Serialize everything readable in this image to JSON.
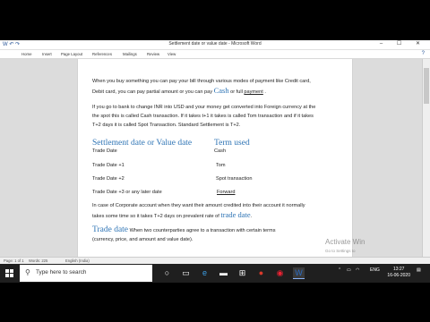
{
  "window": {
    "title": "Settlement date or value date - Microsoft Word",
    "controls": "– ☐ ✕"
  },
  "ribbon": {
    "tabs": [
      "Home",
      "Insert",
      "Page Layout",
      "References",
      "Mailings",
      "Review",
      "View"
    ]
  },
  "document": {
    "p1_part1": "When you buy something you can pay your bill through various modes of payment like Credit card,",
    "p1_part2a": "Debit card, you can pay partial amount  or you can pay ",
    "p1_cash": "Cash",
    "p1_part2b": " or full ",
    "p1_full": "payment",
    "p1_end": " .",
    "p2_line1": "If you go to bank to change INR into USD and your money get converted into Foreign currency at the",
    "p2_line2": "the spot this is called Cash transaction. If it takes t+1 it takes is called Tom transaction and if it takes",
    "p2_line3": "T+2 days it is called Spot Transaction.  Standard Settlement is T+2.",
    "table_heading_left": "Settlement date or Value date",
    "table_heading_right": "Term used",
    "table_rows": [
      {
        "left": "Trade Date",
        "right": "Cash"
      },
      {
        "left": "Trade Date +1",
        "right": "Tom"
      },
      {
        "left": "Trade Date +2",
        "right": "Spot transaction"
      },
      {
        "left": "Trade Date +3 or any later date",
        "right": "Forward"
      }
    ],
    "p3_line1": "In case of Corporate account when they want their amount credited into their account it normally",
    "p3_line2a": "takes some time  so it takes T+2  days on prevalent rate of ",
    "p3_line2b": "trade date",
    "p3_line2c": ".",
    "p4_heading": "Trade date",
    "p4_line1": " When two counterparties agree to a transaction with certain terms",
    "p4_line2": "(currency, price, and amount and value date)."
  },
  "statusbar": {
    "page": "Page: 1 of 1",
    "words": "Words: 225",
    "language": "English (India)"
  },
  "watermark": {
    "line1": "Activate Win",
    "line2": "Go to Settings to"
  },
  "taskbar": {
    "search_placeholder": "Type here to search",
    "lang": "ENG",
    "time": "13:27",
    "date": "16-06-2020"
  },
  "colors": {
    "accent": "#2e74b5",
    "taskbar": "#1f1f1f"
  }
}
